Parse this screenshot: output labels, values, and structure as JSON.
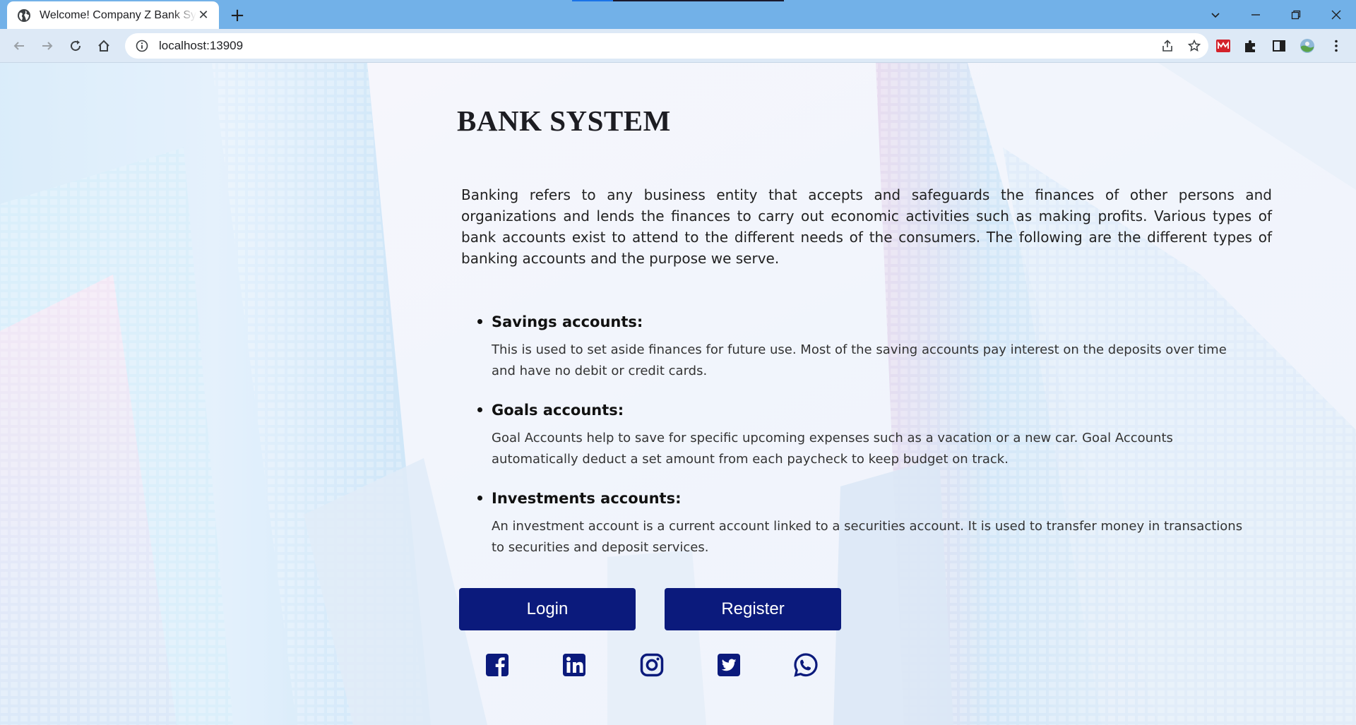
{
  "browser": {
    "tab_title": "Welcome! Company Z Bank System",
    "tab_close": "✕",
    "new_tab": "+",
    "url": "localhost:13909"
  },
  "page": {
    "heading": "BANK SYSTEM",
    "intro": "Banking refers to any business entity that accepts and safeguards the finances of other persons and organizations and lends the finances to carry out economic activities such as making profits. Various types of bank accounts exist to attend to the different needs of the consumers. The following are the different types of banking accounts and the purpose we serve.",
    "accounts": [
      {
        "title": "Savings accounts:",
        "description": "This is used to set aside finances for future use. Most of the saving accounts pay interest on the deposits over time and have no debit or credit cards."
      },
      {
        "title": "Goals accounts:",
        "description": "Goal Accounts help to save for specific upcoming expenses such as a vacation or a new car. Goal Accounts automatically deduct a set amount from each paycheck to keep budget on track."
      },
      {
        "title": "Investments accounts:",
        "description": "An investment account is a current account linked to a securities account. It is used to transfer money in transactions to securities and deposit services."
      }
    ],
    "buttons": {
      "login": "Login",
      "register": "Register"
    },
    "social_icons": [
      "facebook-icon",
      "linkedin-icon",
      "instagram-icon",
      "twitter-icon",
      "whatsapp-icon"
    ]
  },
  "colors": {
    "button_bg": "#0b1a7c",
    "icon_color": "#0b1a7c",
    "titlebar": "#72b1e8",
    "toolbar": "#dde9f6"
  }
}
